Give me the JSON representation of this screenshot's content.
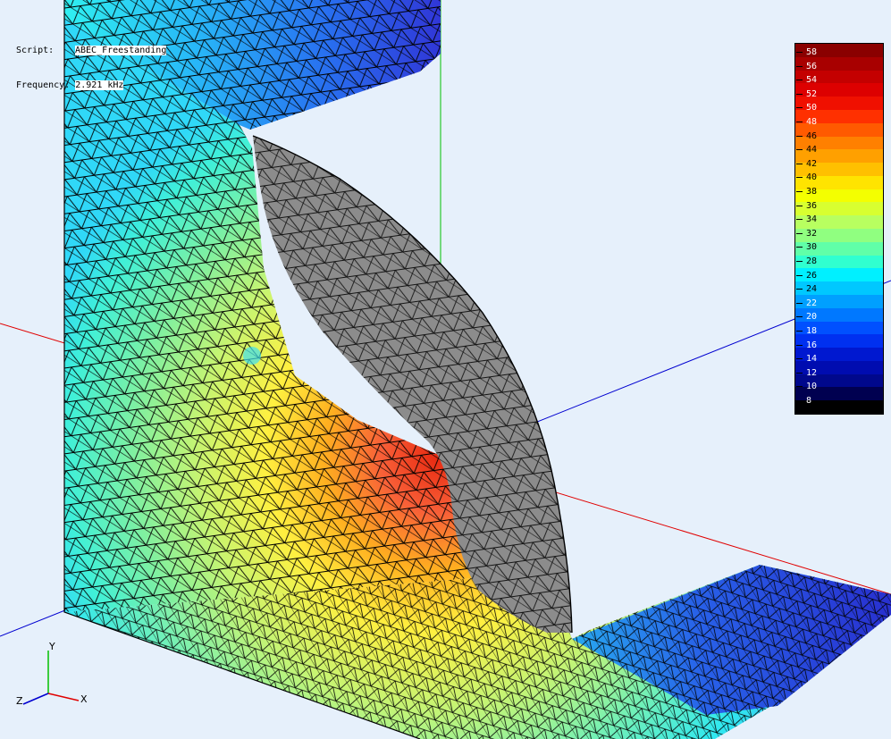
{
  "header": {
    "script_label": "Script:",
    "script_value": "ABEC_Freestanding",
    "frequency_label": "Frequency:",
    "frequency_value": "2.921 kHz"
  },
  "colors": {
    "background": "#e6f0fb",
    "x_axis": "#e00000",
    "y_axis": "#00b000",
    "z_axis": "#0000d0",
    "horn_surface": "#8c8c8c"
  },
  "legend": {
    "ticks": [
      "58",
      "56",
      "54",
      "52",
      "50",
      "48",
      "46",
      "44",
      "42",
      "40",
      "38",
      "36",
      "34",
      "32",
      "30",
      "28",
      "26",
      "24",
      "22",
      "20",
      "18",
      "16",
      "14",
      "12",
      "10",
      "8"
    ],
    "bands": [
      "#8a0000",
      "#a80000",
      "#c40000",
      "#dd0000",
      "#f01000",
      "#ff3000",
      "#ff5a00",
      "#ff8000",
      "#ffa000",
      "#ffc000",
      "#ffe400",
      "#f4ff00",
      "#d8ff30",
      "#b8ff60",
      "#90ff80",
      "#60ffa8",
      "#30ffd0",
      "#00f0ff",
      "#00c8ff",
      "#00a0ff",
      "#0078ff",
      "#0050ff",
      "#0030f0",
      "#0018d0",
      "#000cb0",
      "#00088c",
      "#000050",
      "#000000"
    ]
  },
  "axis_triad": {
    "x_label": "X",
    "y_label": "Y",
    "z_label": "Z"
  }
}
